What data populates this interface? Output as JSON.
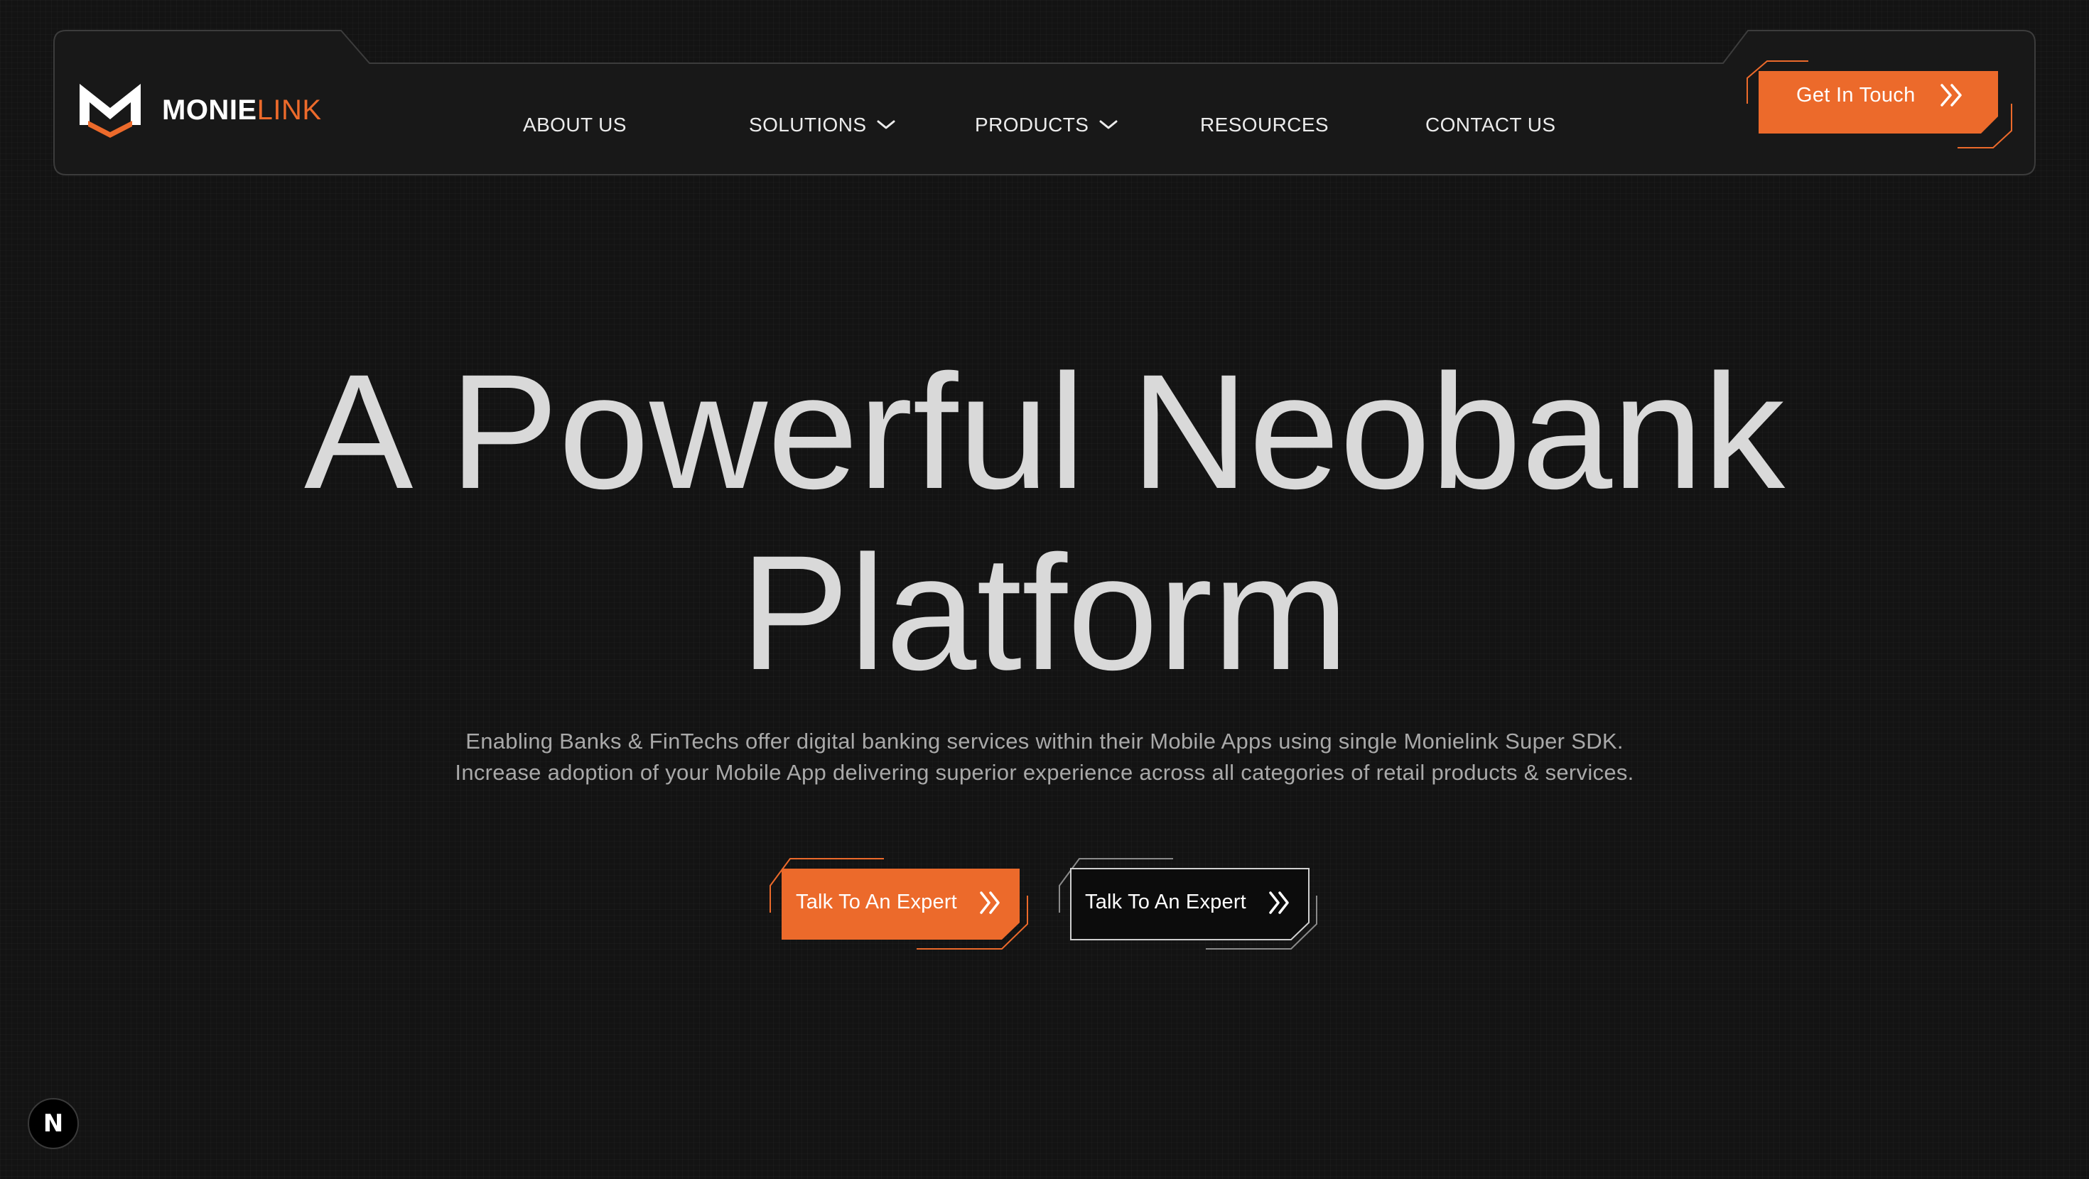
{
  "brand": {
    "name_primary": "MONIE",
    "name_accent": "LINK",
    "accent_color": "#ec6a2b",
    "logo_icon": "monielink-logo-icon"
  },
  "nav": {
    "items": [
      {
        "label": "ABOUT US",
        "has_dropdown": false
      },
      {
        "label": "SOLUTIONS",
        "has_dropdown": true,
        "icon": "chevron-down-icon"
      },
      {
        "label": "PRODUCTS",
        "has_dropdown": true,
        "icon": "chevron-down-icon"
      },
      {
        "label": "RESOURCES",
        "has_dropdown": false
      },
      {
        "label": "CONTACT US",
        "has_dropdown": false
      }
    ],
    "cta": {
      "label": "Get In Touch",
      "icon": "double-chevron-right-icon"
    }
  },
  "hero": {
    "title_line1": "A Powerful Neobank",
    "title_line2": "Platform",
    "subtitle_line1": "Enabling Banks & FinTechs offer digital banking services within their Mobile Apps using single Monielink Super SDK.",
    "subtitle_line2": "Increase adoption of your Mobile App delivering superior experience across all categories of retail products & services.",
    "buttons": [
      {
        "label": "Talk To An Expert",
        "style": "filled",
        "icon": "double-chevron-right-icon"
      },
      {
        "label": "Talk To An Expert",
        "style": "outline",
        "icon": "double-chevron-right-icon"
      }
    ]
  },
  "badge": {
    "label": "N",
    "icon": "nextjs-indicator-icon"
  },
  "colors": {
    "background": "#131313",
    "accent": "#ec6a2b",
    "text": "#d9d9d9",
    "muted_text": "#a9a9a9"
  }
}
